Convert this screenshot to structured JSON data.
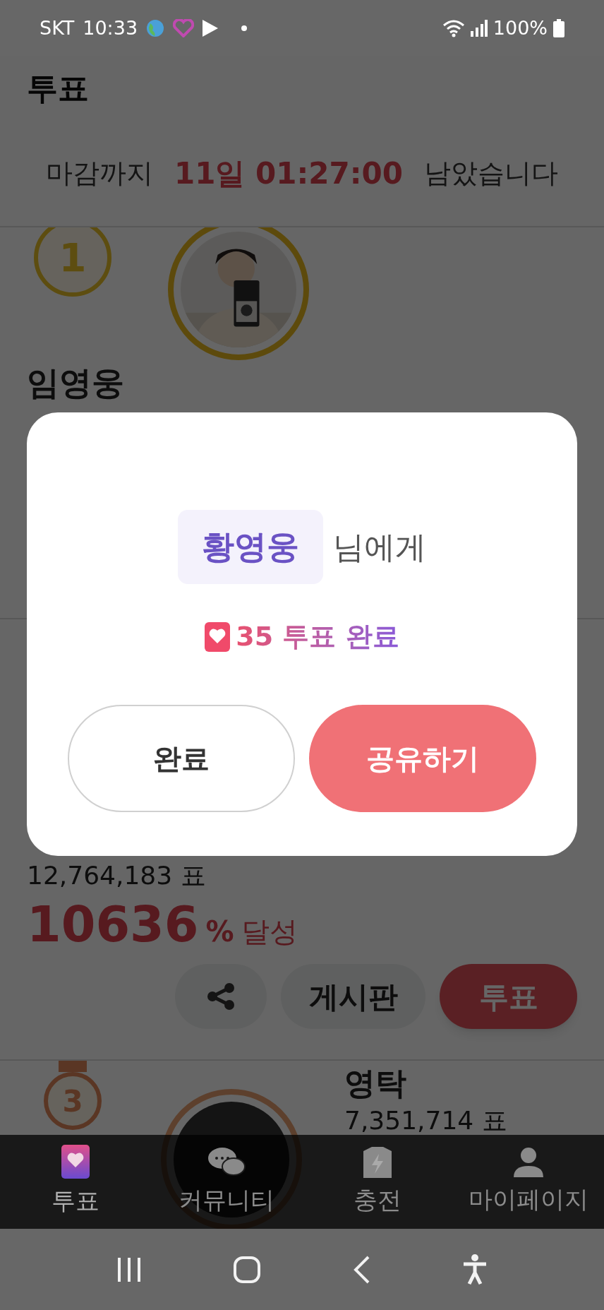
{
  "status_bar": {
    "carrier": "SKT",
    "time": "10:33",
    "battery": "100%"
  },
  "header": {
    "title": "투표"
  },
  "countdown": {
    "prefix": "마감까지",
    "remaining": "11일 01:27:00",
    "suffix": "남았습니다"
  },
  "ranking": [
    {
      "rank": "1",
      "name": "임영웅"
    },
    {
      "votes": "12,764,183 표",
      "percent": "10636",
      "percent_unit": "%",
      "percent_suffix": "달성",
      "board_button": "게시판",
      "vote_button": "투표"
    },
    {
      "rank": "3",
      "name": "영탁",
      "votes": "7,351,714 표",
      "avatar": {
        "kind": "dark"
      }
    }
  ],
  "bottom_nav": [
    {
      "label": "투표",
      "selected": true
    },
    {
      "label": "커뮤니티",
      "selected": false
    },
    {
      "label": "충전",
      "selected": false
    },
    {
      "label": "마이페이지",
      "selected": false
    }
  ],
  "modal": {
    "recipient": "황영웅",
    "recipient_suffix": "님에게",
    "result": "35 투표 완료",
    "buttons": [
      {
        "label": "완료",
        "kind": "outline"
      },
      {
        "label": "공유하기",
        "kind": "primary"
      }
    ]
  }
}
